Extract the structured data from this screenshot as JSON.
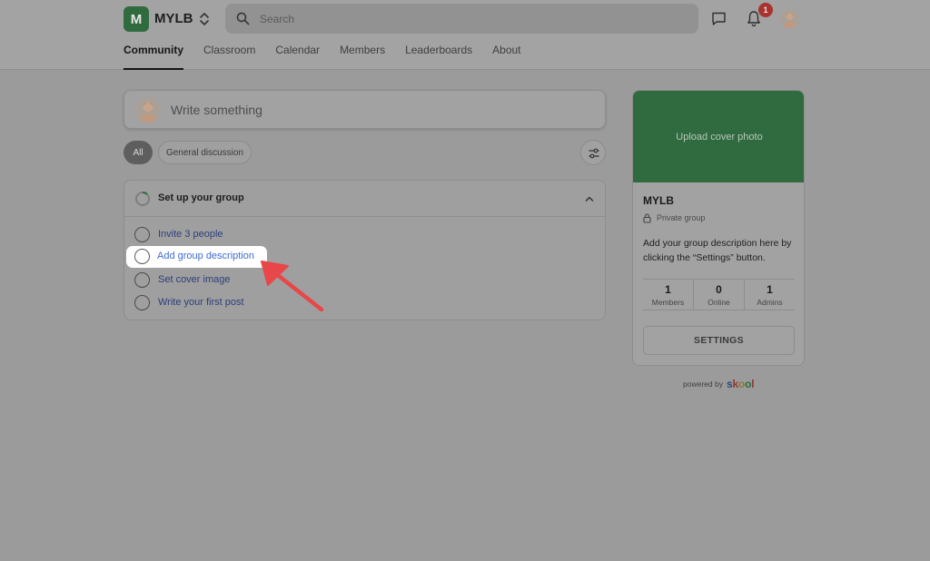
{
  "header": {
    "logo_letter": "M",
    "group_name": "MYLB",
    "search_placeholder": "Search",
    "notification_count": "1"
  },
  "tabs": [
    {
      "label": "Community",
      "active": true
    },
    {
      "label": "Classroom",
      "active": false
    },
    {
      "label": "Calendar",
      "active": false
    },
    {
      "label": "Members",
      "active": false
    },
    {
      "label": "Leaderboards",
      "active": false
    },
    {
      "label": "About",
      "active": false
    }
  ],
  "composer": {
    "placeholder": "Write something"
  },
  "filters": {
    "all": "All",
    "general": "General discussion"
  },
  "setup": {
    "title": "Set up your group",
    "tasks": [
      {
        "label": "Invite 3 people"
      },
      {
        "label": "Add group description"
      },
      {
        "label": "Set cover image"
      },
      {
        "label": "Write your first post"
      }
    ]
  },
  "group_card": {
    "cover_label": "Upload cover photo",
    "name": "MYLB",
    "privacy": "Private group",
    "description": "Add your group description here by clicking the “Settings” button.",
    "stats": [
      {
        "value": "1",
        "label": "Members"
      },
      {
        "value": "0",
        "label": "Online"
      },
      {
        "value": "1",
        "label": "Admins"
      }
    ],
    "settings_label": "SETTINGS"
  },
  "footer": {
    "powered_by": "powered by",
    "brand": [
      "s",
      "k",
      "o",
      "o",
      "l"
    ]
  },
  "colors": {
    "brand_green": "#2f6b3e",
    "highlight_arrow": "#e8474a",
    "link_blue": "#3d6bd0",
    "badge_red": "#a8332f"
  }
}
